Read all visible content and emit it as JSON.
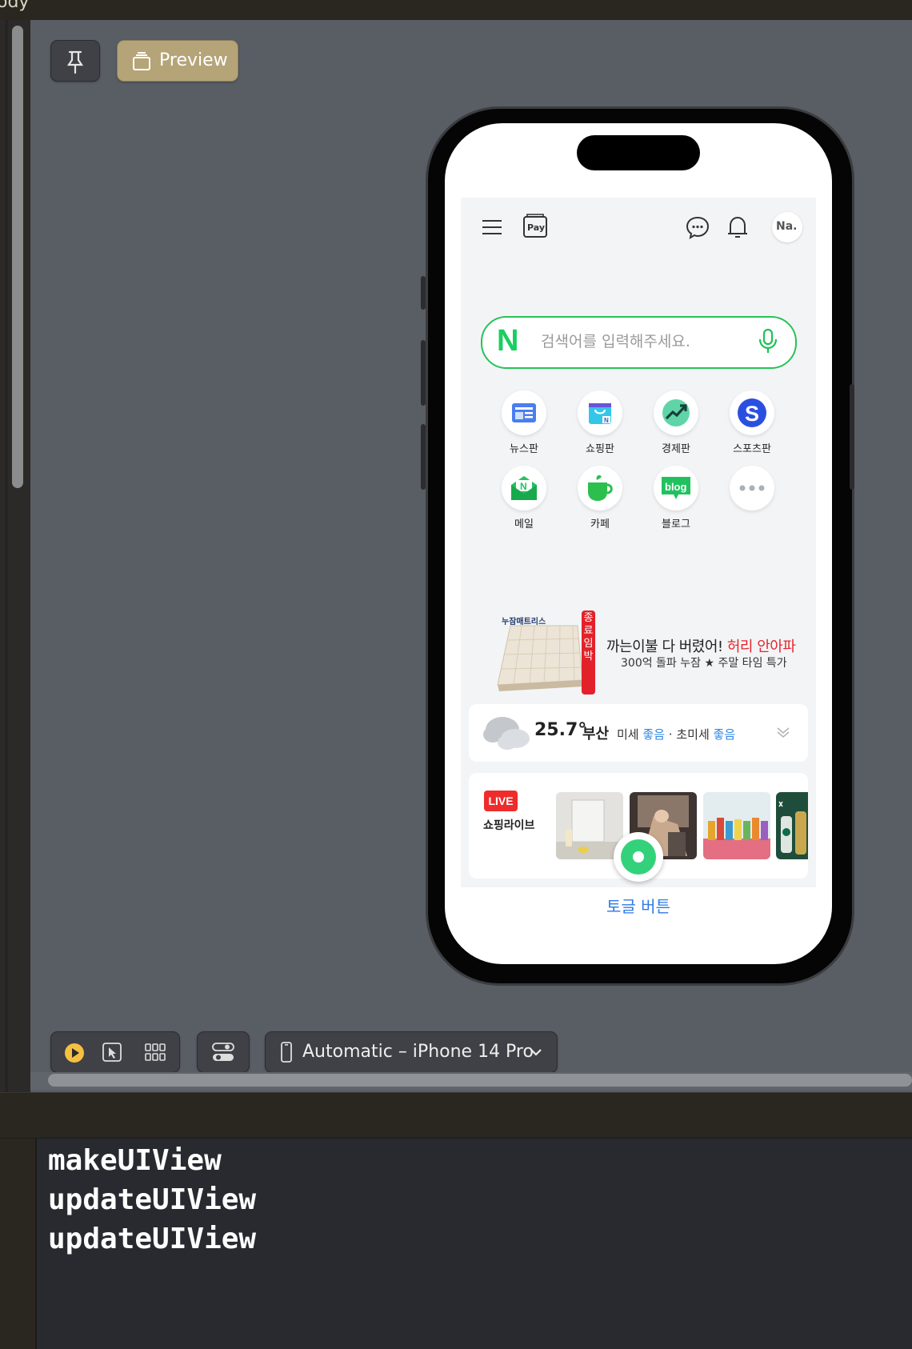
{
  "editor": {
    "top_fragment": "ody"
  },
  "canvas_toolbar": {
    "preview_label": "Preview"
  },
  "device_selector": {
    "label": "Automatic – iPhone 14 Pro"
  },
  "naver": {
    "avatar_text": "Na.",
    "pay_label": "Pay",
    "search_placeholder": "검색어를 입력해주세요.",
    "search_logo": "N",
    "services": [
      {
        "label": "뉴스판"
      },
      {
        "label": "쇼핑판"
      },
      {
        "label": "경제판"
      },
      {
        "label": "스포츠판"
      },
      {
        "label": "메일"
      },
      {
        "label": "카페"
      },
      {
        "label": "블로그"
      },
      {
        "label": ""
      }
    ],
    "ad": {
      "brand": "누잠매트리스",
      "tag": "종료임박",
      "title_main": "까는이불 다 버렸어! ",
      "title_accent": "허리 안아파",
      "subtitle": "300억 돌파 누잠 ★ 주말 타임 특가"
    },
    "weather": {
      "temp": "25.7°",
      "city": "부산",
      "fine_dust_label": "미세",
      "fine_dust_value": "좋음",
      "separator": "·",
      "ultra_dust_label": "초미세",
      "ultra_dust_value": "좋음"
    },
    "live": {
      "badge": "LIVE",
      "label": "쇼핑라이브"
    },
    "colors": {
      "naver_green": "#19ce60",
      "live_red": "#ee2c2c",
      "link_blue": "#2f7ae5"
    }
  },
  "toggle_button": {
    "label": "토글 버튼"
  },
  "console": {
    "lines": [
      "makeUIView",
      "updateUIView",
      "updateUIView"
    ]
  }
}
